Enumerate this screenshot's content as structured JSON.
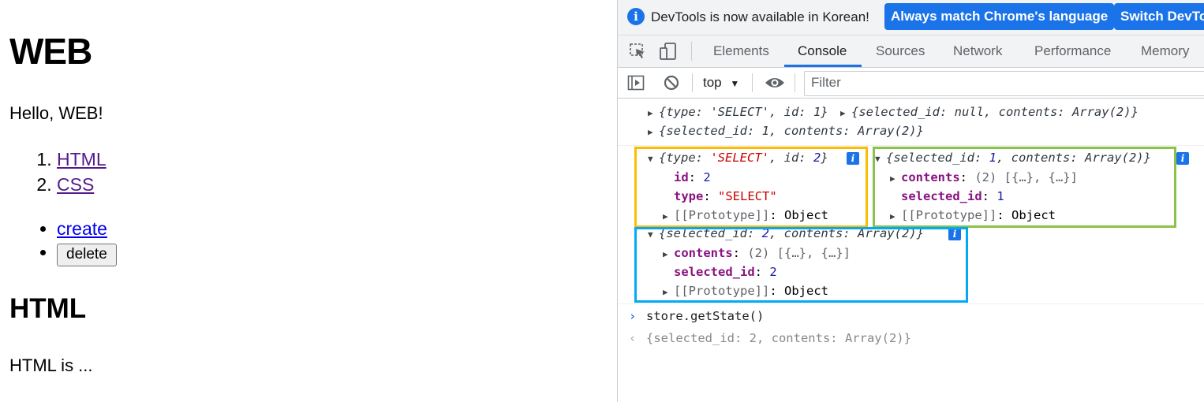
{
  "page": {
    "heading": "WEB",
    "greeting": "Hello, WEB!",
    "topics": [
      "HTML",
      "CSS"
    ],
    "create_link": "create",
    "delete_button": "delete",
    "section_title": "HTML",
    "section_body": "HTML is ..."
  },
  "devtools": {
    "infobar": {
      "message": "DevTools is now available in Korean!",
      "match_button": "Always match Chrome's language",
      "switch_button": "Switch DevTo"
    },
    "tabs": [
      "Elements",
      "Console",
      "Sources",
      "Network",
      "Performance",
      "Memory"
    ],
    "active_tab": "Console",
    "toolbar": {
      "context": "top",
      "filter_placeholder": "Filter"
    },
    "log": {
      "action1_summary": "{type: 'SELECT', id: 1}",
      "state1_summary_inline": "{selected_id: null, contents: Array(2)}",
      "state1_summary": "{selected_id: 1, contents: Array(2)}",
      "action2": {
        "type_str": "'SELECT'",
        "id_val": "2",
        "prop_id_key": "id",
        "prop_id_val": "2",
        "prop_type_key": "type",
        "prop_type_val": "\"SELECT\"",
        "proto_label": "[[Prototype]]",
        "proto_val": "Object"
      },
      "state_prev": {
        "selected_val": "1",
        "contents_key": "contents",
        "contents_val": "(2) [{…}, {…}]",
        "selected_key": "selected_id",
        "selected_prop_val": "1",
        "proto_label": "[[Prototype]]",
        "proto_val": "Object"
      },
      "state_next": {
        "selected_val": "2",
        "contents_key": "contents",
        "contents_val": "(2) [{…}, {…}]",
        "selected_key": "selected_id",
        "selected_prop_val": "2",
        "proto_label": "[[Prototype]]",
        "proto_val": "Object"
      },
      "command_input": "store.getState()",
      "command_result": "{selected_id: 2, contents: Array(2)}"
    },
    "highlight_colors": {
      "action": "#fbbc05",
      "prev_state": "#8bc34a",
      "next_state": "#03a9f4"
    }
  }
}
